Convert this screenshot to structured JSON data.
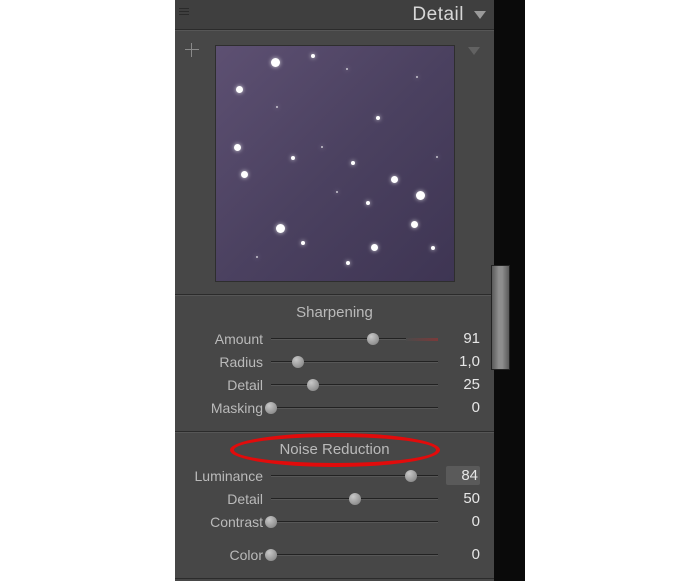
{
  "header": {
    "title": "Detail"
  },
  "groups": {
    "sharpening": {
      "title": "Sharpening",
      "amount": {
        "label": "Amount",
        "value": "91",
        "pos": 61
      },
      "radius": {
        "label": "Radius",
        "value": "1,0",
        "pos": 16
      },
      "detail": {
        "label": "Detail",
        "value": "25",
        "pos": 25
      },
      "masking": {
        "label": "Masking",
        "value": "0",
        "pos": 0
      }
    },
    "noise": {
      "title": "Noise Reduction",
      "luminance": {
        "label": "Luminance",
        "value": "84",
        "pos": 84
      },
      "detail": {
        "label": "Detail",
        "value": "50",
        "pos": 50
      },
      "contrast": {
        "label": "Contrast",
        "value": "0",
        "pos": 0
      },
      "color": {
        "label": "Color",
        "value": "0",
        "pos": 0
      }
    }
  }
}
